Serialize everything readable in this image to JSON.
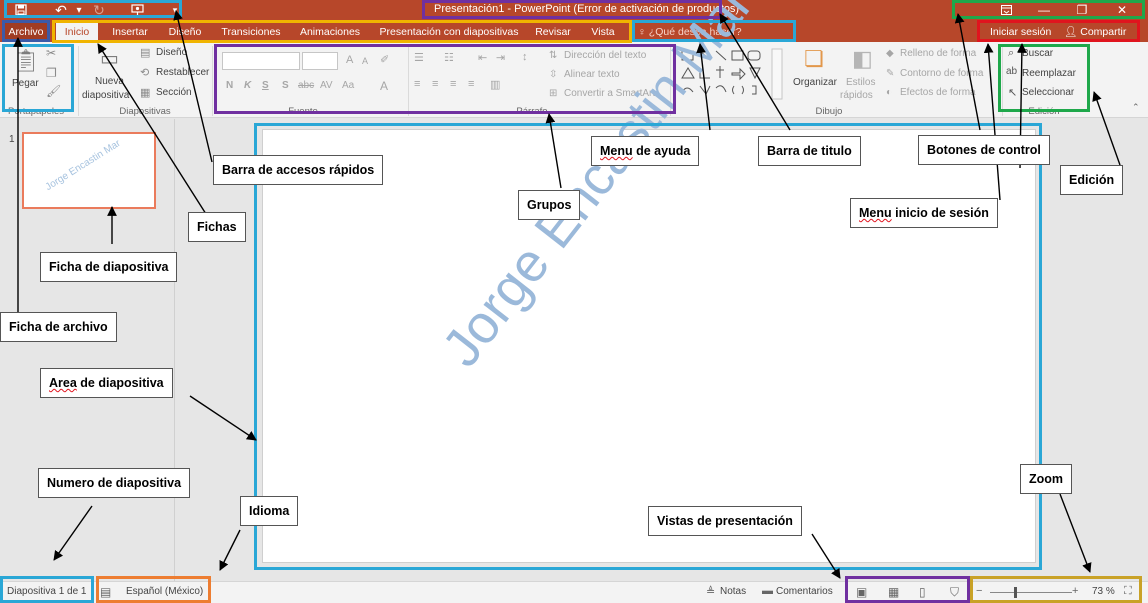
{
  "titlebar": {
    "title": "Presentación1 - PowerPoint (Error de activación de productos)",
    "quick_access": [
      "save-icon",
      "undo-icon",
      "redo-icon",
      "start-from-beginning-icon",
      "customize-dropdown-icon"
    ],
    "window_controls": [
      "ribbon-display-options-icon",
      "minimize-icon",
      "restore-icon",
      "close-icon"
    ]
  },
  "tabs": [
    "Archivo",
    "Inicio",
    "Insertar",
    "Diseño",
    "Transiciones",
    "Animaciones",
    "Presentación con diapositivas",
    "Revisar",
    "Vista"
  ],
  "tell_me": "¿Qué desea hacer?",
  "account": {
    "signin": "Iniciar sesión",
    "share": "Compartir"
  },
  "ribbon": {
    "clipboard": {
      "paste": "Pegar",
      "label": "Portapapeles"
    },
    "slides": {
      "new_slide_1": "Nueva",
      "new_slide_2": "diapositiva",
      "layout": "Diseño",
      "reset": "Restablecer",
      "section": "Sección",
      "label": "Diapositivas"
    },
    "font": {
      "label": "Fuente",
      "buttons": [
        "N",
        "K",
        "S",
        "S",
        "abc",
        "AV",
        "Aa",
        "A"
      ],
      "grow": "A",
      "shrink": "A"
    },
    "paragraph": {
      "text_direction": "Dirección del texto",
      "align_text": "Alinear texto",
      "smartart": "Convertir a SmartArt",
      "label": "Párrafo"
    },
    "drawing": {
      "arrange": "Organizar",
      "quick_styles_1": "Estilos",
      "quick_styles_2": "rápidos",
      "fill": "Relleno de forma",
      "outline": "Contorno de forma",
      "effects": "Efectos de forma",
      "label": "Dibujo"
    },
    "editing": {
      "find": "Buscar",
      "replace": "Reemplazar",
      "select": "Seleccionar",
      "label": "Edición"
    }
  },
  "thumbnail": {
    "number": "1",
    "watermark": "Jorge Encastin Mar"
  },
  "slide": {
    "watermark": "Jorge Encastin Mar"
  },
  "statusbar": {
    "slide_number": "Diapositiva 1 de 1",
    "language": "Español (México)",
    "notes": "Notas",
    "comments": "Comentarios",
    "zoom": "73 %"
  },
  "callouts": {
    "quick_access": "Barra de accesos rápidos",
    "tabs": "Fichas",
    "slide_thumb": "Ficha de diapositiva",
    "file_tab": "Ficha de archivo",
    "slide_area_1": "Area",
    "slide_area_2": " de diapositiva",
    "slide_number": "Numero de diapositiva",
    "language": "Idioma",
    "groups": "Grupos",
    "help_1": "Menu",
    "help_2": " de ayuda",
    "title_bar": "Barra de titulo",
    "controls": "Botones de control",
    "signin_1": "Menu",
    "signin_2": " inicio de sesión",
    "editing": "Edición",
    "views": "Vistas de presentación",
    "zoom": "Zoom"
  },
  "colors": {
    "accent": "#b7472a",
    "purple": "#7030a0",
    "blue": "#2aa7d6",
    "yellow": "#f0b400",
    "orange": "#ed7d31",
    "green": "#1fa84b",
    "red": "#e0141e"
  }
}
